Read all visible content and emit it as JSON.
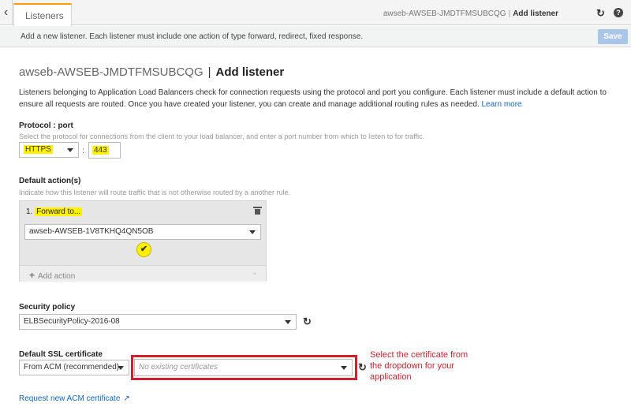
{
  "topbar": {
    "back_icon": "chevron-left-icon",
    "tab_label": "Listeners",
    "breadcrumb_lb": "awseb-AWSEB-JMDTFMSUBCQG",
    "breadcrumb_sep": "|",
    "breadcrumb_page": "Add listener"
  },
  "infobar": {
    "message": "Add a new listener. Each listener must include one action of type forward, redirect, fixed response.",
    "save_label": "Save"
  },
  "page": {
    "title_lb": "awseb-AWSEB-JMDTFMSUBCQG",
    "title_sep": "|",
    "title_page": "Add listener",
    "intro": "Listeners belonging to Application Load Balancers check for connection requests using the protocol and port you configure. Each listener must include a default action to ensure all requests are routed. Once you have created your listener, you can create and manage additional routing rules as needed.",
    "learn_more": "Learn more"
  },
  "protocol": {
    "label": "Protocol : port",
    "hint": "Select the protocol for connections from the client to your load balancer, and enter a port number from which to listen to for traffic.",
    "protocol_value": "HTTPS",
    "colon": ":",
    "port_value": "443"
  },
  "default_actions": {
    "label": "Default action(s)",
    "hint": "Indicate how this listener will route traffic that is not otherwise routed by a another rule.",
    "action_index": "1.",
    "action_type": "Forward to...",
    "target_group": "awseb-AWSEB-1V8TKHQ4QN5OB",
    "add_action": "Add action"
  },
  "security_policy": {
    "label": "Security policy",
    "value": "ELBSecurityPolicy-2016-08"
  },
  "ssl_certificate": {
    "label": "Default SSL certificate",
    "source_value": "From ACM (recommended)",
    "certificate_placeholder": "No existing certificates",
    "request_link": "Request new ACM certificate"
  },
  "annotation": {
    "note": "Select the certificate from the dropdown for your application",
    "color": "#d0202e"
  },
  "colors": {
    "highlight": "#fff200",
    "link": "#1166bb",
    "tab_accent": "#ff9900",
    "save_disabled": "#a9c5e8"
  }
}
